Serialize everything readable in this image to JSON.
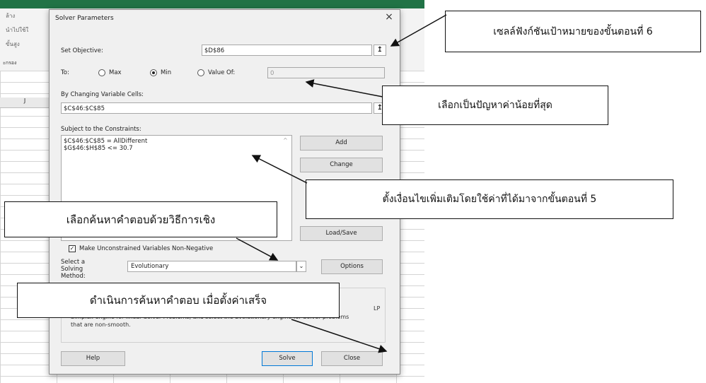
{
  "excel": {
    "ribbon_items": [
      "ล้าง",
      "นำไปใช้ใ",
      "ขั้นสูง"
    ],
    "ribbon_group": "ะกรอง",
    "column_header": "J"
  },
  "dialog": {
    "title": "Solver Parameters",
    "close_glyph": "×",
    "set_objective_label": "Set Objective:",
    "objective_value": "$D$86",
    "to_label": "To:",
    "max_label": "Max",
    "min_label": "Min",
    "value_of_label": "Value Of:",
    "value_of_value": "0",
    "selected_goal": "Min",
    "changing_cells_label": "By Changing Variable Cells:",
    "changing_cells_value": "$C$46:$C$85",
    "constraints_label": "Subject to the Constraints:",
    "constraints": [
      "$C$46:$C$85 = AllDifferent",
      "$G$46:$H$85 <= 30.7"
    ],
    "buttons": {
      "add": "Add",
      "change": "Change",
      "load_save": "Load/Save",
      "options": "Options",
      "help": "Help",
      "solve": "Solve",
      "close": "Close"
    },
    "nonneg_label": "Make Unconstrained Variables Non-Negative",
    "nonneg_checked": true,
    "method_label": "Select a Solving Method:",
    "method_value": "Evolutionary",
    "desc_fragment_1": "LP",
    "desc_line_2": "Simplex engine for linear Solver Problems, and select the Evolutionary engine for Solver problems",
    "desc_line_3": "that are non-smooth."
  },
  "callouts": {
    "objective": "เซลล์ฟังก์ชันเป้าหมายของขั้นตอนที่ 6",
    "minimize": "เลือกเป็นปัญหาค่าน้อยที่สุด",
    "constraints": "ตั้งเงื่อนไขเพิ่มเติมโดยใช้ค่าที่ได้มาจากขั้นตอนที่ 5",
    "method": "เลือกค้นหาคำตอบด้วยวิธีการเชิง",
    "solve": "ดำเนินการค้นหาคำตอบ เมื่อตั้งค่าเสร็จ"
  }
}
